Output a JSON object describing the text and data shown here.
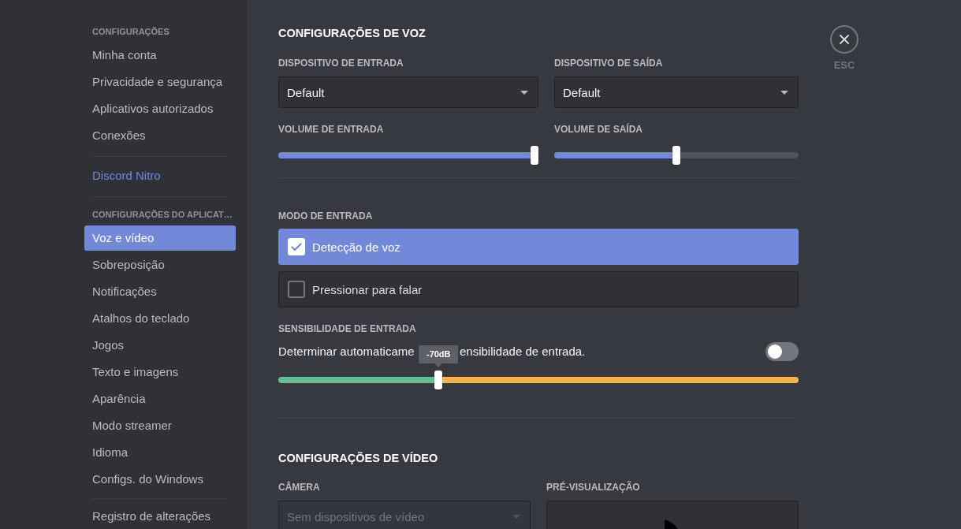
{
  "sidebar": {
    "groups": [
      {
        "header": "CONFIGURAÇÕES",
        "items": [
          {
            "label": "Minha conta",
            "kind": "item",
            "selected": false
          },
          {
            "label": "Privacidade e segurança",
            "kind": "item",
            "selected": false
          },
          {
            "label": "Aplicativos autorizados",
            "kind": "item",
            "selected": false
          },
          {
            "label": "Conexões",
            "kind": "item",
            "selected": false
          }
        ]
      },
      {
        "items": [
          {
            "label": "Discord Nitro",
            "kind": "nitro",
            "selected": false
          }
        ]
      },
      {
        "header": "CONFIGURAÇÕES DO APLICAT…",
        "items": [
          {
            "label": "Voz e vídeo",
            "kind": "item",
            "selected": true
          },
          {
            "label": "Sobreposição",
            "kind": "item",
            "selected": false
          },
          {
            "label": "Notificações",
            "kind": "item",
            "selected": false
          },
          {
            "label": "Atalhos do teclado",
            "kind": "item",
            "selected": false
          },
          {
            "label": "Jogos",
            "kind": "item",
            "selected": false
          },
          {
            "label": "Texto e imagens",
            "kind": "item",
            "selected": false
          },
          {
            "label": "Aparência",
            "kind": "item",
            "selected": false
          },
          {
            "label": "Modo streamer",
            "kind": "item",
            "selected": false
          },
          {
            "label": "Idioma",
            "kind": "item",
            "selected": false
          },
          {
            "label": "Configs. do Windows",
            "kind": "item",
            "selected": false
          }
        ]
      },
      {
        "items": [
          {
            "label": "Registro de alterações",
            "kind": "item",
            "selected": false
          }
        ]
      }
    ]
  },
  "voice_settings": {
    "title": "CONFIGURAÇÕES DE VOZ",
    "devices": [
      {
        "label": "DISPOSITIVO DE ENTRADA",
        "value": "Default"
      },
      {
        "label": "DISPOSITIVO DE SAÍDA",
        "value": "Default"
      }
    ],
    "volumes": [
      {
        "label": "VOLUME DE ENTRADA",
        "level": 1.0
      },
      {
        "label": "VOLUME DE SAÍDA",
        "level": 0.5
      }
    ],
    "input_mode": {
      "label": "MODO DE ENTRADA",
      "options": [
        {
          "label": "Detecção de voz",
          "selected": true
        },
        {
          "label": "Pressionar para falar",
          "selected": false
        }
      ]
    },
    "input_sensitivity": {
      "label": "SENSIBILIDADE DE ENTRADA",
      "auto_text_parts": [
        "Determinar automaticame",
        "ensibilidade de entrada."
      ],
      "auto_on": false,
      "level": 0.305,
      "reading": "-70dB"
    }
  },
  "video_settings": {
    "title": "CONFIGURAÇÕES DE VÍDEO",
    "camera": {
      "label": "CÂMERA",
      "value": "Sem dispositivos de vídeo",
      "disabled": true
    },
    "preview": {
      "label": "PRÉ-VISUALIZAÇÃO"
    }
  },
  "close": {
    "hint": "ESC"
  }
}
